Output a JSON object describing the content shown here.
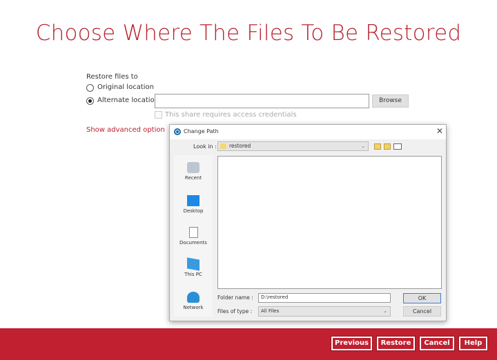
{
  "page": {
    "title": "Choose Where The Files To Be Restored"
  },
  "restore": {
    "heading": "Restore files to",
    "original": "Original location",
    "alternate": "Alternate location",
    "selected": "alternate",
    "path_value": "",
    "browse": "Browse",
    "credentials": "This share requires access credentials",
    "advanced": "Show advanced option"
  },
  "dialog": {
    "title": "Change Path",
    "look_in_label": "Look in :",
    "look_in_value": "restored",
    "places": [
      {
        "label": "Recent",
        "icon": "recent-icon"
      },
      {
        "label": "Desktop",
        "icon": "desktop-icon"
      },
      {
        "label": "Documents",
        "icon": "documents-icon"
      },
      {
        "label": "This PC",
        "icon": "this-pc-icon"
      },
      {
        "label": "Network",
        "icon": "network-icon"
      }
    ],
    "folder_name_label": "Folder name :",
    "folder_name_value": "D:\\restored",
    "files_type_label": "Files of type :",
    "files_type_value": "All Files",
    "ok": "OK",
    "cancel": "Cancel"
  },
  "footer": {
    "previous": "Previous",
    "restore": "Restore",
    "cancel": "Cancel",
    "help": "Help"
  },
  "colors": {
    "accent": "#b8202e",
    "footer": "#c0202f"
  }
}
